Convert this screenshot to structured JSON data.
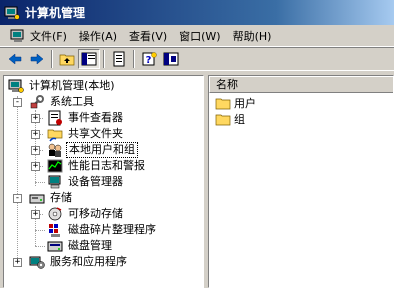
{
  "window": {
    "title": "计算机管理"
  },
  "menu": [
    {
      "label": "文件(F)"
    },
    {
      "label": "操作(A)"
    },
    {
      "label": "查看(V)"
    },
    {
      "label": "窗口(W)"
    },
    {
      "label": "帮助(H)"
    }
  ],
  "toolbar": {
    "buttons": [
      "back-icon",
      "forward-icon",
      "up-folder-icon",
      "show-hide-tree-icon",
      "export-list-icon",
      "help-icon",
      "properties-icon"
    ]
  },
  "tree": {
    "root": "计算机管理(本地)",
    "system_tools": "系统工具",
    "event_viewer": "事件查看器",
    "shared_folders": "共享文件夹",
    "local_users_groups": "本地用户和组",
    "perf_logs": "性能日志和警报",
    "device_manager": "设备管理器",
    "storage": "存储",
    "removable_storage": "可移动存储",
    "defrag": "磁盘碎片整理程序",
    "disk_management": "磁盘管理",
    "services_apps": "服务和应用程序"
  },
  "list": {
    "column_name": "名称",
    "items": [
      "用户",
      "组"
    ]
  },
  "colors": {
    "title_start": "#0a246a",
    "title_end": "#a6caf0",
    "face": "#d4d0c8"
  }
}
